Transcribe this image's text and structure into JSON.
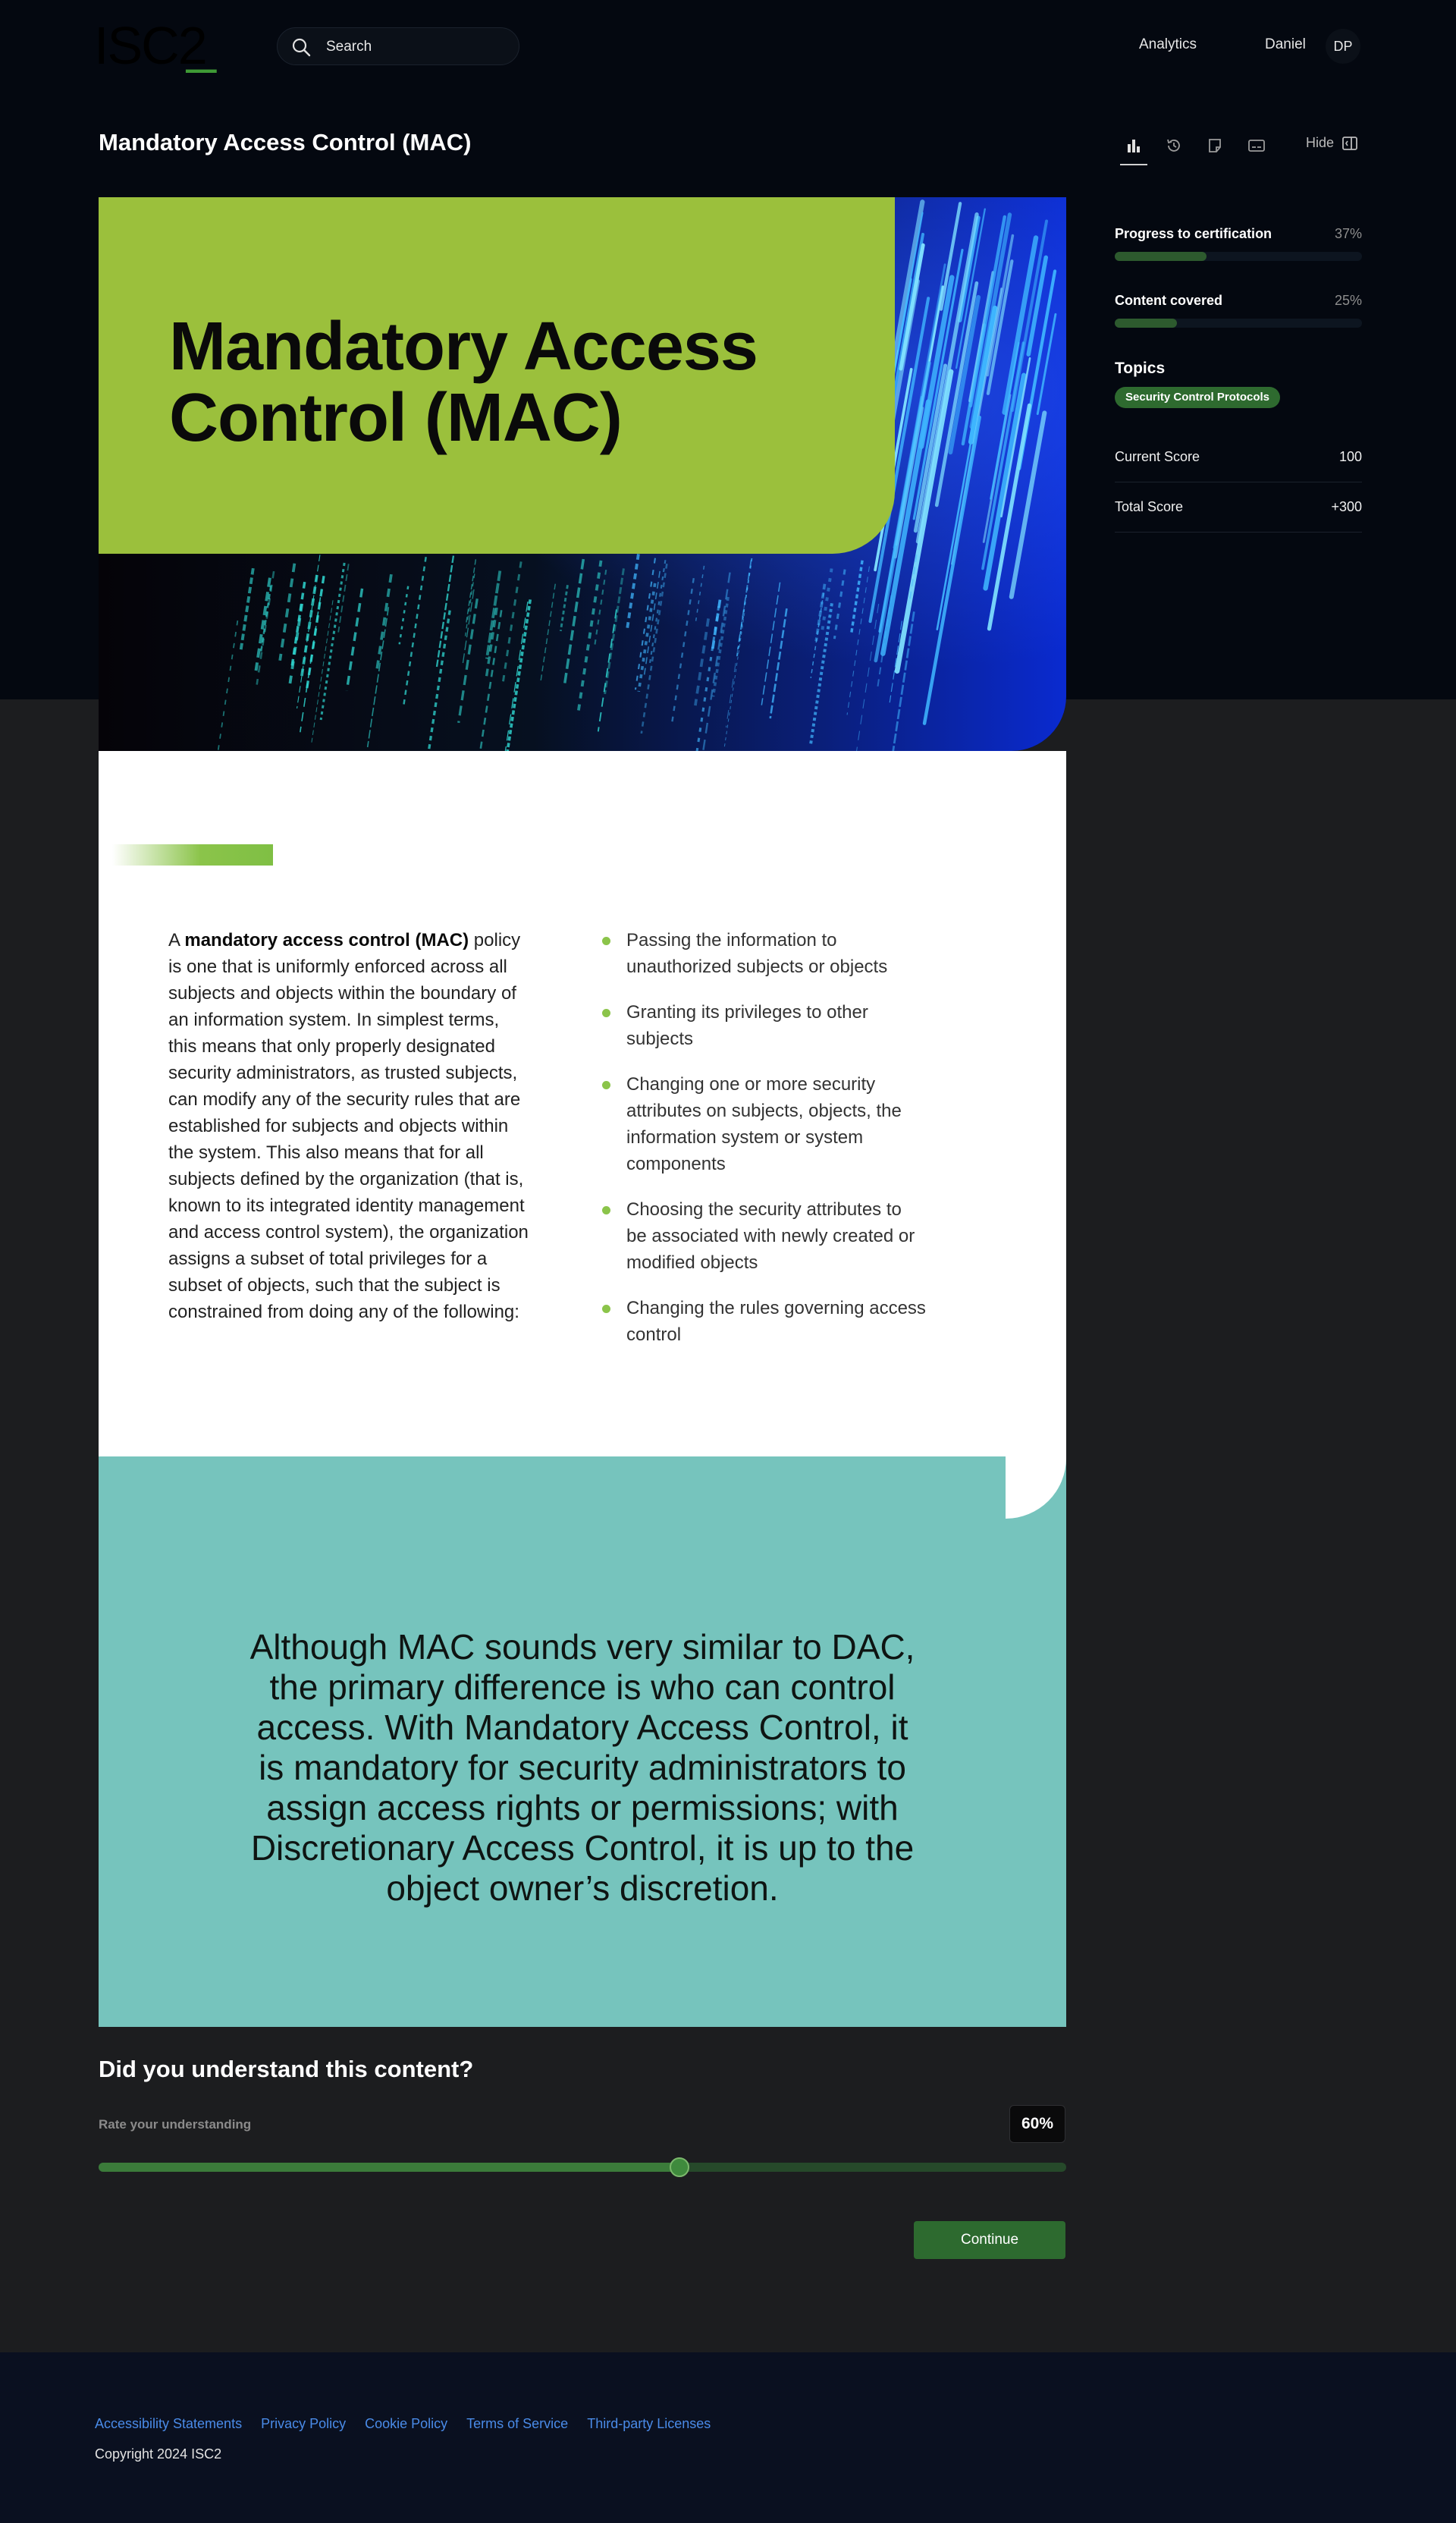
{
  "header": {
    "logo_text": "ISC2",
    "search_placeholder": "Search",
    "analytics_label": "Analytics",
    "user_name": "Daniel",
    "user_initials": "DP"
  },
  "page": {
    "title": "Mandatory Access Control (MAC)",
    "toolbar": {
      "icons": [
        "analytics-icon",
        "history-icon",
        "notes-icon",
        "captions-icon",
        "panel-icon"
      ],
      "hide_label": "Hide"
    }
  },
  "hero": {
    "title": "Mandatory Access Control (MAC)",
    "title_box_color": "#9bc03c"
  },
  "content": {
    "paragraph_prefix": "A ",
    "paragraph_bold": "mandatory access control (MAC)",
    "paragraph_rest": " policy is one that is uniformly enforced across all subjects and objects within the boundary of an information system. In simplest terms, this means that only properly designated security administrators, as trusted subjects, can modify any of the security rules that are established for subjects and objects within the system. This also means that for all subjects defined by the organization (that is, known to its integrated identity management and access control system), the organization assigns a subset of total privileges for a subset of objects, such that the subject is constrained from doing any of the following:",
    "bullets": [
      "Passing the information to unauthorized subjects or objects",
      "Granting its privileges to other subjects",
      "Changing one or more security attributes on subjects, objects, the information system or system components",
      "Choosing the security attributes to be associated with newly created or modified objects",
      "Changing the rules governing access control"
    ],
    "bullet_color": "#8bc44a"
  },
  "quote": {
    "text": "Although MAC sounds very similar to DAC, the primary difference is who can control access. With Mandatory Access Control, it is mandatory for security administrators to assign access rights or permissions; with Discretionary Access Control, it is up to the object owner’s discretion.",
    "background_color": "#76c4bd"
  },
  "feedback": {
    "title": "Did you understand this content?",
    "rate_label": "Rate your understanding",
    "rate_value_text": "60%",
    "rate_value": 60,
    "continue_label": "Continue"
  },
  "sidebar": {
    "progress": {
      "label": "Progress to certification",
      "value_text": "37%",
      "value": 37
    },
    "content_covered": {
      "label": "Content covered",
      "value_text": "25%",
      "value": 25
    },
    "topics_title": "Topics",
    "topics": [
      "Security Control Protocols"
    ],
    "current_score": {
      "label": "Current Score",
      "value": "100"
    },
    "total_score": {
      "label": "Total Score",
      "value": "+300"
    }
  },
  "footer": {
    "links": [
      "Accessibility Statements",
      "Privacy Policy",
      "Cookie Policy",
      "Terms of Service",
      "Third-party Licenses"
    ],
    "copyright": "Copyright 2024 ISC2"
  },
  "colors": {
    "accent_green": "#2d6a2f",
    "brand_lime": "#9bc03c",
    "link_blue": "#4a8be8"
  }
}
